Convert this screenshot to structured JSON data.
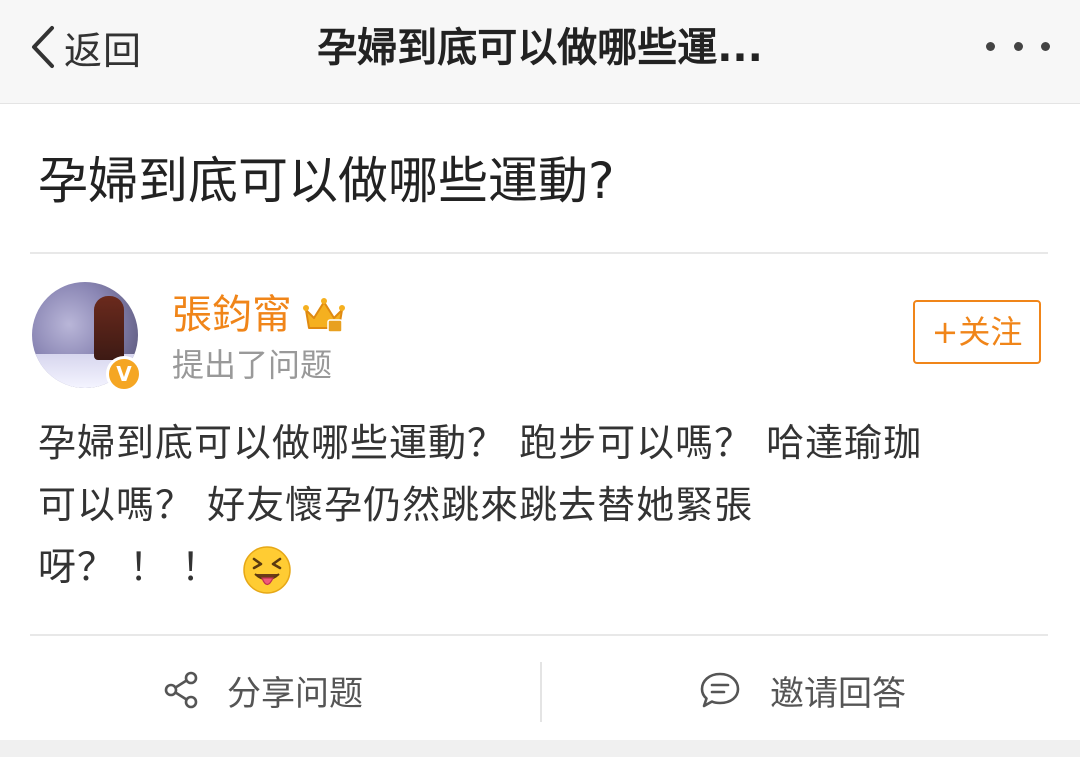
{
  "nav": {
    "back_label": "返回",
    "title": "孕婦到底可以做哪些運..."
  },
  "question": {
    "title": "孕婦到底可以做哪些運動?"
  },
  "author": {
    "name": "張鈞甯",
    "badge": "V",
    "action_text": "提出了问题",
    "follow_label": "+关注",
    "accent_color": "#f08519"
  },
  "body": {
    "lines": [
      "孕婦到底可以做哪些運動？ 跑步可以嗎？ 哈達瑜珈",
      "可以嗎？ 好友懷孕仍然跳來跳去替她緊張",
      "呀？ ！ ！"
    ],
    "emoji": "squinting-face-with-tongue"
  },
  "actions": {
    "share_label": "分享问题",
    "invite_label": "邀请回答"
  },
  "icons": {
    "back": "chevron-left-icon",
    "more": "more-dots-icon",
    "crown": "crown-icon",
    "share": "share-icon",
    "invite": "chat-bubble-icon"
  }
}
